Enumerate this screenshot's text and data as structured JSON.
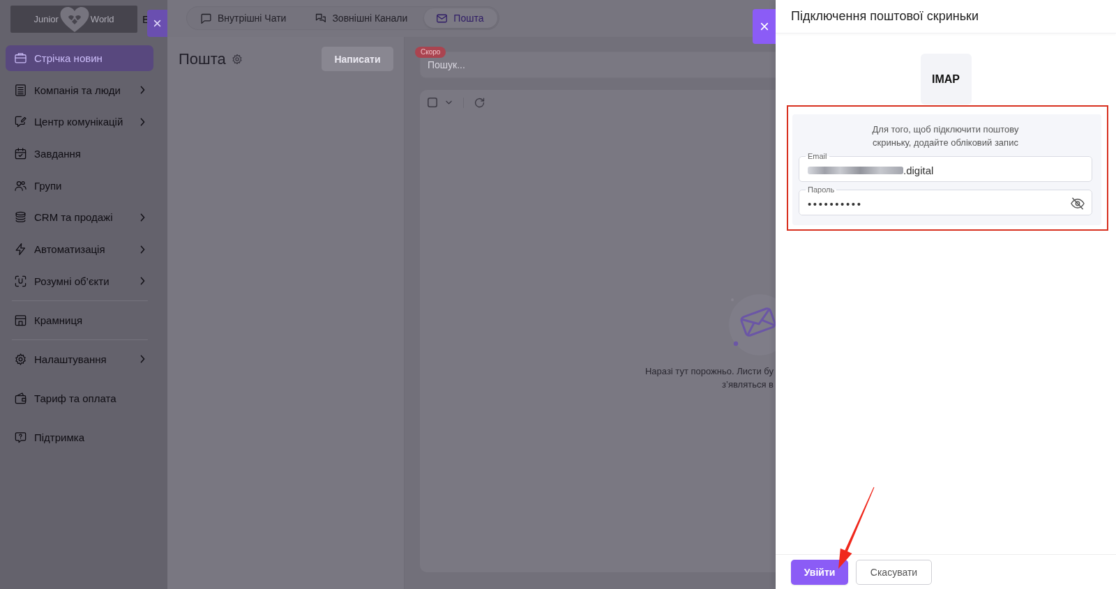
{
  "sidebar": {
    "logo": {
      "text_left": "Junior",
      "text_right": "World"
    },
    "language_label": "E",
    "sections": [
      {
        "divider": true,
        "items": [
          {
            "label": "Стрічка новин",
            "selected": true,
            "expandable": false
          },
          {
            "label": "Компанія та люди",
            "selected": false,
            "expandable": true
          },
          {
            "label": "Центр комунікацій",
            "selected": false,
            "expandable": true
          },
          {
            "label": "Завдання",
            "selected": false,
            "expandable": false
          },
          {
            "label": "Групи",
            "selected": false,
            "expandable": false
          },
          {
            "label": "CRM та продажі",
            "selected": false,
            "expandable": true
          },
          {
            "label": "Автоматизація",
            "selected": false,
            "expandable": true
          },
          {
            "label": "Розумні об’єкти",
            "selected": false,
            "expandable": true
          }
        ]
      },
      {
        "divider": true,
        "items": [
          {
            "label": "Крамниця",
            "selected": false,
            "expandable": false
          }
        ]
      },
      {
        "divider": false,
        "items": [
          {
            "label": "Налаштування",
            "selected": false,
            "expandable": true
          }
        ]
      },
      {
        "divider": false,
        "items": [
          {
            "label": "Тариф та оплата",
            "selected": false,
            "expandable": false
          }
        ]
      },
      {
        "divider": false,
        "items": [
          {
            "label": "Підтримка",
            "selected": false,
            "expandable": false
          }
        ]
      }
    ]
  },
  "tabs": [
    {
      "label": "Внутрішні Чати",
      "selected": false
    },
    {
      "label": "Зовнішні Канали",
      "selected": false
    },
    {
      "label": "Пошта",
      "selected": true
    }
  ],
  "mail": {
    "title": "Пошта",
    "compose_button": "Написати",
    "search": {
      "placeholder": "Пошук...",
      "badge": "Скоро"
    },
    "toolbar": {
      "select_all_checked": false
    },
    "empty_state": {
      "lines": [
        "Наразі тут порожньо. Листи бу",
        "з’являться в"
      ]
    }
  },
  "drawer": {
    "title": "Підключення поштової скриньки",
    "protocol": "IMAP",
    "hint": "Для того, щоб підключити поштову скриньку, додайте обліковий запис",
    "fields": [
      {
        "kind": "email",
        "label": "Email",
        "value": ".digital",
        "redacted": true
      },
      {
        "kind": "password",
        "label": "Пароль",
        "value": "••••••••••",
        "visible": false
      }
    ],
    "buttons": [
      {
        "label": "Увійти",
        "kind": "primary"
      },
      {
        "label": "Скасувати",
        "kind": "secondary"
      }
    ]
  },
  "annotations": {
    "highlight_frame": true,
    "arrow": true
  }
}
